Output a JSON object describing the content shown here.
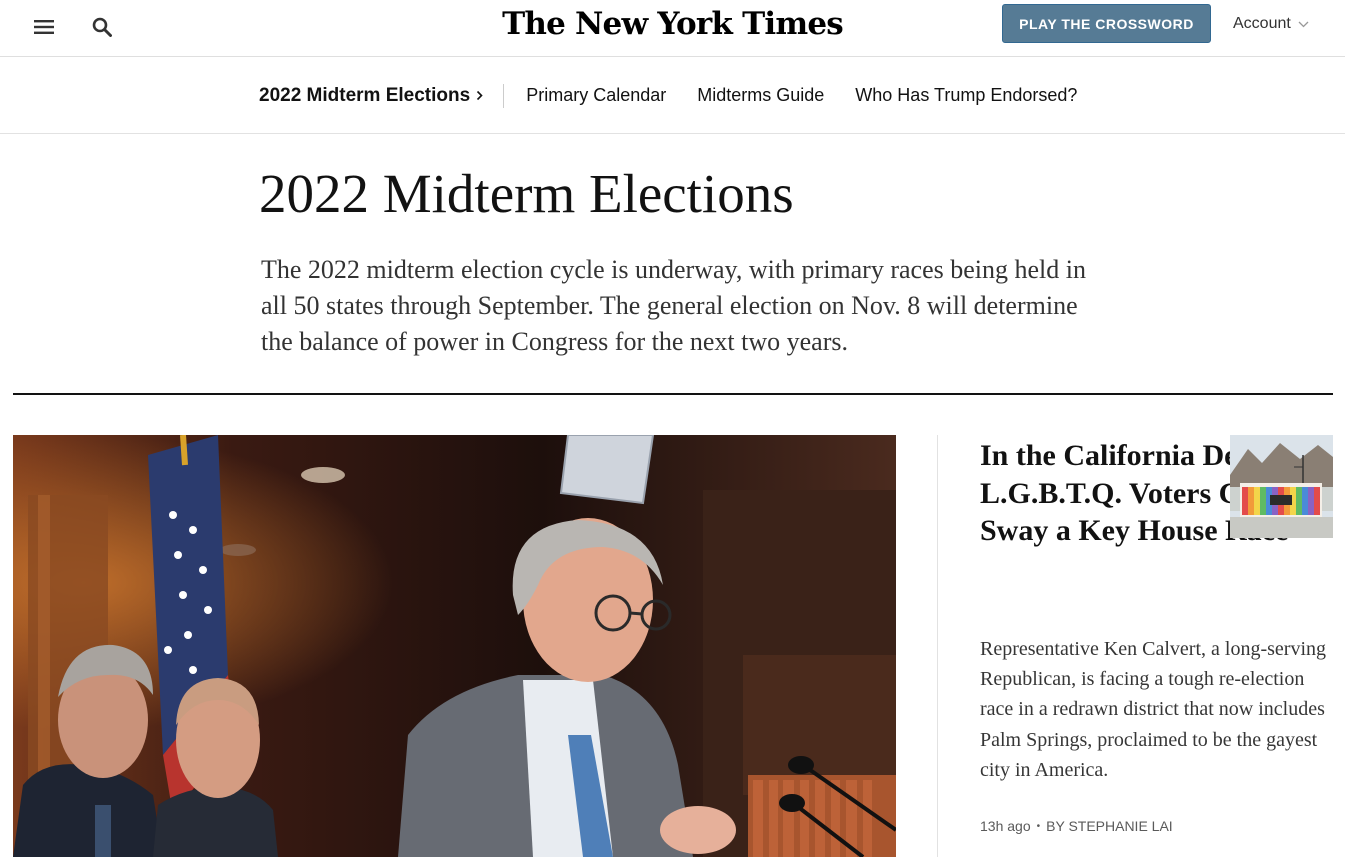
{
  "header": {
    "logo_text": "The New York Times",
    "crossword_label": "PLAY THE CROSSWORD",
    "account_label": "Account",
    "icons": [
      "hamburger-menu-icon",
      "search-icon",
      "chevron-down-icon"
    ]
  },
  "subnav": {
    "title": "2022 Midterm Elections",
    "links": [
      "Primary Calendar",
      "Midterms Guide",
      "Who Has Trump Endorsed?"
    ]
  },
  "page": {
    "title": "2022 Midterm Elections",
    "dek": "The 2022 midterm election cycle is underway, with primary races being held in all 50 states through September. The general election on Nov. 8 will determine the balance of power in Congress for the next two years."
  },
  "secondary_story": {
    "headline": "In the California Desert, L.G.B.T.Q. Voters Could Sway a Key House Race",
    "summary": "Representative Ken Calvert, a long-serving Republican, is facing a tough re-election race in a redrawn district that now includes Palm Springs, proclaimed to be the gayest city in America.",
    "timestamp": "13h ago",
    "byline": "By STEPHANIE LAI"
  },
  "colors": {
    "crossword_button": "#567b95",
    "text": "#121212",
    "rule": "#121212",
    "divider": "#e2e2e2"
  }
}
